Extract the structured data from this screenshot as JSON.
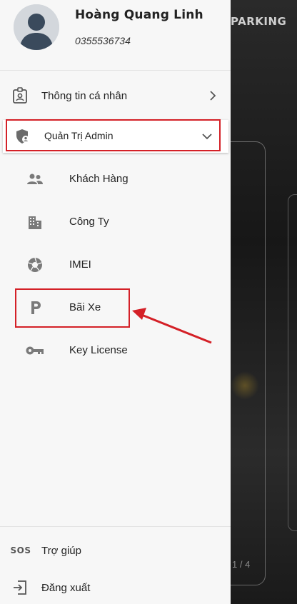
{
  "background": {
    "brand_text": "PARKING",
    "pager": "1 / 4"
  },
  "profile": {
    "name": "Hoàng Quang Linh",
    "phone": "0355536734"
  },
  "menu": {
    "personal_info": {
      "label": "Thông tin cá nhân",
      "icon": "contact-card-icon"
    },
    "admin": {
      "label": "Quản Trị Admin",
      "icon": "shield-user-icon",
      "expanded": true
    },
    "admin_items": [
      {
        "label": "Khách Hàng",
        "icon": "people-icon"
      },
      {
        "label": "Công Ty",
        "icon": "building-icon"
      },
      {
        "label": "IMEI",
        "icon": "aperture-icon"
      },
      {
        "label": "Bãi Xe",
        "icon": "parking-icon"
      },
      {
        "label": "Key License",
        "icon": "key-icon"
      }
    ],
    "help": {
      "label": "Trợ giúp",
      "icon": "sos-icon",
      "icon_text": "SOS"
    },
    "logout": {
      "label": "Đăng xuất",
      "icon": "logout-icon"
    }
  },
  "colors": {
    "highlight": "#d42027",
    "drawer_bg": "#f7f7f7",
    "icon_gray": "#7a7a7a"
  }
}
